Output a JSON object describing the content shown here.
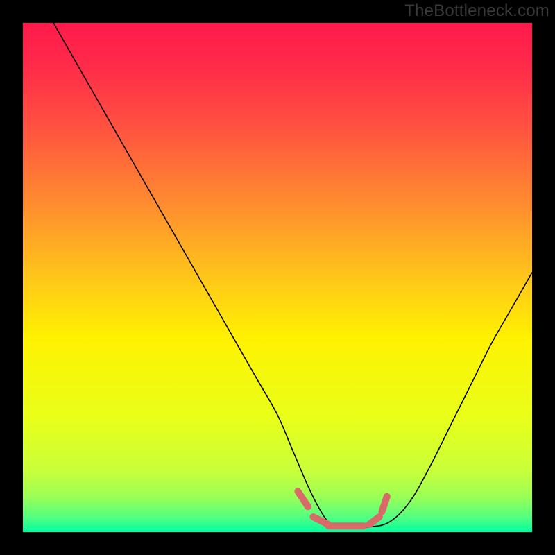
{
  "watermark": "TheBottleneck.com",
  "colors": {
    "frame": "#000000",
    "gradient_stops": [
      {
        "offset": 0.0,
        "color": "#ff1a4b"
      },
      {
        "offset": 0.08,
        "color": "#ff2a4a"
      },
      {
        "offset": 0.2,
        "color": "#ff5040"
      },
      {
        "offset": 0.35,
        "color": "#ff8a30"
      },
      {
        "offset": 0.5,
        "color": "#ffc61a"
      },
      {
        "offset": 0.62,
        "color": "#fff200"
      },
      {
        "offset": 0.78,
        "color": "#e8ff1a"
      },
      {
        "offset": 0.88,
        "color": "#c8ff3a"
      },
      {
        "offset": 0.93,
        "color": "#9bff55"
      },
      {
        "offset": 0.97,
        "color": "#55ff80"
      },
      {
        "offset": 1.0,
        "color": "#00ffa0"
      }
    ],
    "curve_stroke": "#000000",
    "band_stroke": "#d86a6a"
  },
  "chart_data": {
    "type": "line",
    "title": "",
    "xlabel": "",
    "ylabel": "",
    "xlim": [
      0,
      100
    ],
    "ylim": [
      0,
      100
    ],
    "grid": false,
    "series": [
      {
        "name": "bottleneck-curve",
        "x": [
          6,
          10,
          14,
          18,
          22,
          26,
          30,
          34,
          38,
          42,
          46,
          50,
          53,
          56,
          58,
          60,
          62,
          65,
          68,
          72,
          76,
          80,
          84,
          88,
          92,
          96,
          100
        ],
        "values": [
          100,
          93,
          86,
          79,
          72,
          65,
          58,
          51,
          44,
          37,
          30,
          23,
          16,
          9,
          5,
          2,
          1,
          1,
          1,
          2,
          6,
          13,
          21,
          29,
          37,
          44,
          51
        ]
      }
    ],
    "annotations": [
      {
        "name": "valley-band",
        "type": "segments",
        "points": [
          [
            54,
            8
          ],
          [
            56,
            5
          ],
          [
            57,
            3
          ],
          [
            60,
            1.5
          ],
          [
            60,
            1.2
          ],
          [
            67,
            1.2
          ],
          [
            68,
            1.5
          ],
          [
            70,
            3
          ],
          [
            70.5,
            4
          ],
          [
            71.5,
            7
          ]
        ],
        "stroke_width_px": 10
      }
    ]
  }
}
